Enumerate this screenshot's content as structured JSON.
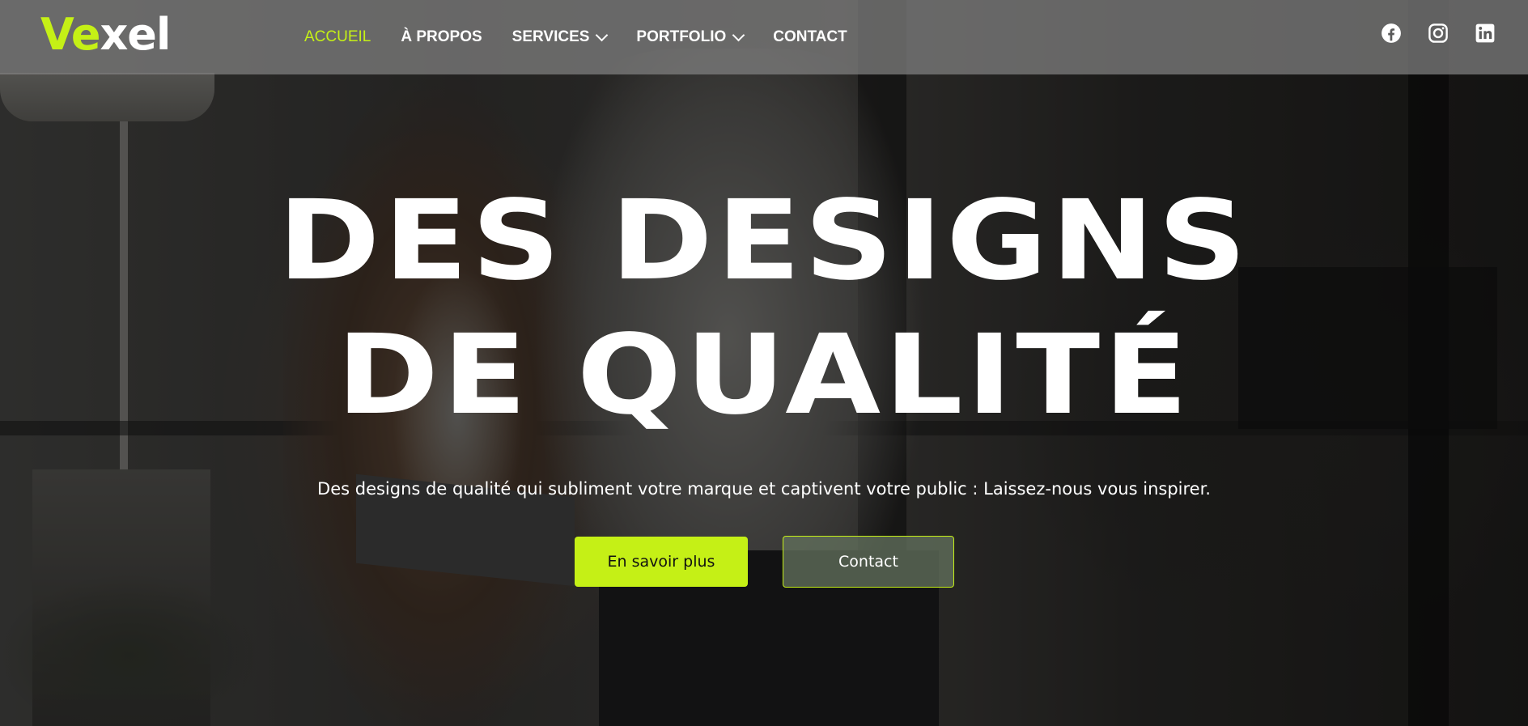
{
  "header": {
    "logo": {
      "accent": "Ve",
      "rest": "xel"
    },
    "nav": [
      {
        "label": "ACCUEIL",
        "active": true,
        "dropdown": false
      },
      {
        "label": "À PROPOS",
        "active": false,
        "dropdown": false
      },
      {
        "label": "SERVICES",
        "active": false,
        "dropdown": true
      },
      {
        "label": "PORTFOLIO",
        "active": false,
        "dropdown": true
      },
      {
        "label": "CONTACT",
        "active": false,
        "dropdown": false
      }
    ],
    "socials": [
      "facebook-icon",
      "instagram-icon",
      "linkedin-icon"
    ]
  },
  "hero": {
    "title_line1": "DES DESIGNS",
    "title_line2": "DE QUALITÉ",
    "subtitle": "Des designs de qualité qui subliment votre marque et captivent votre public : Laissez-nous vous inspirer.",
    "primary_button": "En savoir plus",
    "secondary_button": "Contact"
  },
  "colors": {
    "accent": "#c5f016",
    "text": "#ffffff",
    "header_bg": "#828282"
  }
}
